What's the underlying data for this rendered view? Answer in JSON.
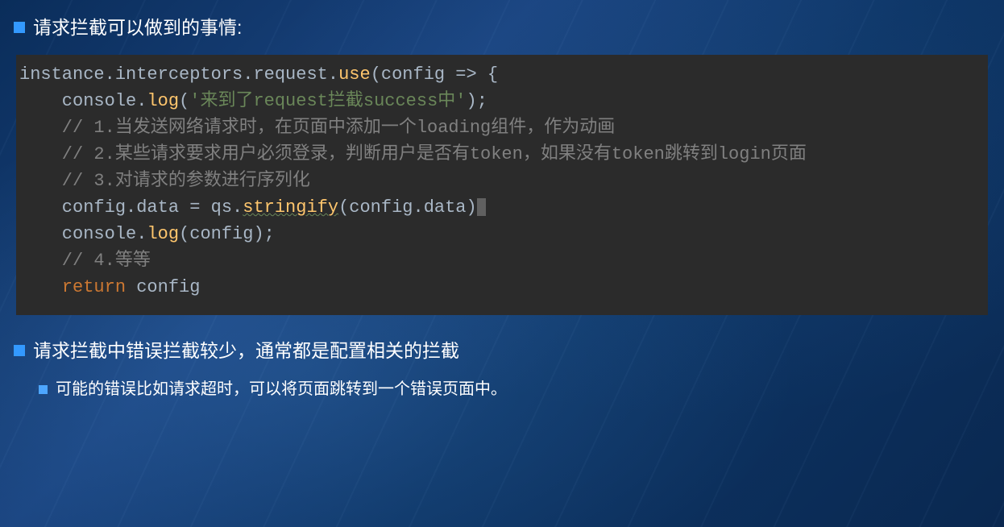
{
  "bullets": {
    "b1": "请求拦截可以做到的事情:",
    "b2": "请求拦截中错误拦截较少，通常都是配置相关的拦截",
    "b3": "可能的错误比如请求超时，可以将页面跳转到一个错误页面中。"
  },
  "code": {
    "l1_a": "instance.interceptors.request.",
    "l1_b": "use",
    "l1_c": "(config => {",
    "l2_a": "    console.",
    "l2_b": "log",
    "l2_c": "(",
    "l2_d": "'来到了request拦截success中'",
    "l2_e": ");",
    "l3": "    // 1.当发送网络请求时，在页面中添加一个loading组件，作为动画",
    "l4": "",
    "l5": "    // 2.某些请求要求用户必须登录，判断用户是否有token，如果没有token跳转到login页面",
    "l6": "",
    "l7": "    // 3.对请求的参数进行序列化",
    "l8_a": "    config.data = qs.",
    "l8_b": "stringify",
    "l8_c": "(config.data)",
    "l9_a": "    console.",
    "l9_b": "log",
    "l9_c": "(config);",
    "l10": "",
    "l11": "    // 4.等等",
    "l12_a": "    ",
    "l12_b": "return",
    "l12_c": " config"
  }
}
